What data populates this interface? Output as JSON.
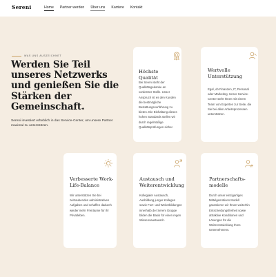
{
  "header": {
    "logo": "Sereni",
    "nav": [
      "Home",
      "Partner werden",
      "Über uns",
      "Karriere",
      "Kontakt"
    ]
  },
  "hero": {
    "eyebrow": "WAS UNS AUSZEICHNET",
    "headline": "Werden Sie Teil unseres Netzwerks und genießen Sie die Stärken der Gemeinschaft.",
    "intro": "Sereni investiert erheblich in das Service-Center, um unsere Partner maximal zu unterstützen."
  },
  "cards": [
    {
      "icon": "award-badge-icon",
      "title": "Höchste Qualität",
      "text": "Bei Sereni steht der Qualitätsgedanke an vorderster Stelle. Unser Anspruch ist es den Kunden die bestmögliche Bestattungsvorführung zu bieten. Die Einhaltung dieses hohen Standards stellen wir durch regelmäßige Qualitätsprüfungen sicher."
    },
    {
      "icon": "support-person-icon",
      "title": "Wertvolle Unterstützung",
      "text": "Egal, ob Finanzen, IT, Personal oder Marketing. Unser Service-Center steht Ihnen mit einem Team von Experten zur Seite, die Sie bei allen Arbeitsprozessen unterstützen."
    },
    {
      "icon": "sun-icon",
      "title": "Verbesserte Work-Life-Balance",
      "text": "Wir unterstützen Sie bei zeitraubenden administrativen Aufgaben und schaffen dadurch wieder mehr Freiräume für Ihr Privatleben."
    },
    {
      "icon": "person-exchange-icon",
      "title": "Austausch und Weiterentwicklung",
      "text": "Kollegialer Austausch, Ausbildung junger Kollegen sowie Fort- und Weiterbildungen innerhalb der Sereni Gruppe bilden die Basis für einen regen Wissensaustausch."
    },
    {
      "icon": "person-add-icon",
      "title": "Partnerschafts-modelle",
      "text": "Durch unser einzigartiges Mittelgemütiven Modell garantieren wir Ihnen weiterhin Entscheidungsfreiheit sowie attraktive Konditionen und Lösungen für die Weiterentwicklung Ihres Unternehmens."
    }
  ],
  "colors": {
    "background": "#f5ede2",
    "card": "#ffffff",
    "accent": "#c9a062"
  }
}
